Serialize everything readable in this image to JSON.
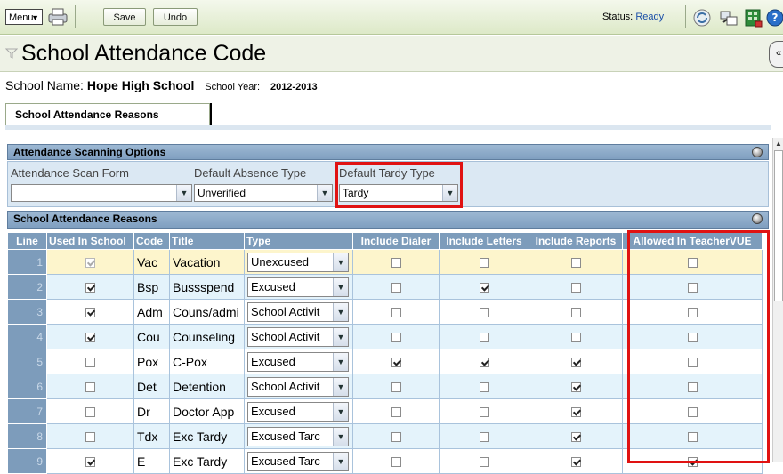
{
  "toolbar": {
    "menu_label": "Menu",
    "save_label": "Save",
    "undo_label": "Undo",
    "status_label": "Status:",
    "status_value": "Ready"
  },
  "page": {
    "title": "School Attendance Code",
    "school_name_label": "School Name:",
    "school_name": "Hope High School",
    "school_year_label": "School Year:",
    "school_year": "2012-2013",
    "tab_label": "School Attendance Reasons"
  },
  "scan_options": {
    "header": "Attendance Scanning Options",
    "scan_form_label": "Attendance Scan Form",
    "scan_form_value": "",
    "absence_type_label": "Default Absence Type",
    "absence_type_value": "Unverified",
    "tardy_type_label": "Default Tardy Type",
    "tardy_type_value": "Tardy"
  },
  "reasons": {
    "header": "School Attendance Reasons",
    "columns": [
      "Line",
      "Used In School",
      "Code",
      "Title",
      "Type",
      "Include Dialer",
      "Include Letters",
      "Include Reports",
      "Allowed In TeacherVUE"
    ],
    "rows": [
      {
        "line": "1",
        "used": true,
        "code": "Vac",
        "title": "Vacation",
        "type": "Unexcused",
        "dialer": false,
        "letters": false,
        "reports": false,
        "teachervue": false
      },
      {
        "line": "2",
        "used": true,
        "code": "Bsp",
        "title": "Bussspend",
        "type": "Excused",
        "dialer": false,
        "letters": true,
        "reports": false,
        "teachervue": false
      },
      {
        "line": "3",
        "used": true,
        "code": "Adm",
        "title": "Couns/admi",
        "type": "School Activit",
        "dialer": false,
        "letters": false,
        "reports": false,
        "teachervue": false
      },
      {
        "line": "4",
        "used": true,
        "code": "Cou",
        "title": "Counseling",
        "type": "School Activit",
        "dialer": false,
        "letters": false,
        "reports": false,
        "teachervue": false
      },
      {
        "line": "5",
        "used": false,
        "code": "Pox",
        "title": "C-Pox",
        "type": "Excused",
        "dialer": true,
        "letters": true,
        "reports": true,
        "teachervue": false
      },
      {
        "line": "6",
        "used": false,
        "code": "Det",
        "title": "Detention",
        "type": "School Activit",
        "dialer": false,
        "letters": false,
        "reports": true,
        "teachervue": false
      },
      {
        "line": "7",
        "used": false,
        "code": "Dr",
        "title": "Doctor App",
        "type": "Excused",
        "dialer": false,
        "letters": false,
        "reports": true,
        "teachervue": false
      },
      {
        "line": "8",
        "used": false,
        "code": "Tdx",
        "title": "Exc Tardy",
        "type": "Excused Tarc",
        "dialer": false,
        "letters": false,
        "reports": true,
        "teachervue": false
      },
      {
        "line": "9",
        "used": true,
        "code": "E",
        "title": "Exc Tardy",
        "type": "Excused Tarc",
        "dialer": false,
        "letters": false,
        "reports": true,
        "teachervue": true
      }
    ]
  },
  "colors": {
    "header_blue": "#7d9cbb",
    "highlight_red": "#e01212",
    "row_alt": "#e4f3fb",
    "row_selected": "#fdf5cc"
  }
}
